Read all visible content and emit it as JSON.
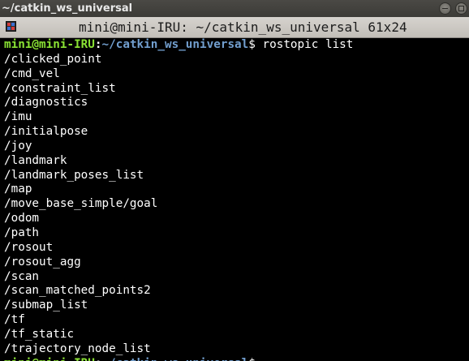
{
  "outer_window": {
    "title": "~/catkin_ws_universal"
  },
  "terminal_window": {
    "title": "mini@mini-IRU: ~/catkin_ws_universal 61x24"
  },
  "prompt": {
    "user_host": "mini@mini-IRU",
    "separator": ":",
    "path": "~/catkin_ws_universal",
    "symbol": "$ ",
    "command": "rostopic list"
  },
  "output_lines": [
    "/clicked_point",
    "/cmd_vel",
    "/constraint_list",
    "/diagnostics",
    "/imu",
    "/initialpose",
    "/joy",
    "/landmark",
    "/landmark_poses_list",
    "/map",
    "/move_base_simple/goal",
    "/odom",
    "/path",
    "/rosout",
    "/rosout_agg",
    "/scan",
    "/scan_matched_points2",
    "/submap_list",
    "/tf",
    "/tf_static",
    "/trajectory_node_list"
  ],
  "colors": {
    "background": "#000000",
    "foreground": "#ffffff",
    "prompt_user": "#8ae234",
    "prompt_path": "#729fcf",
    "title_bar": "#3c3b37"
  }
}
